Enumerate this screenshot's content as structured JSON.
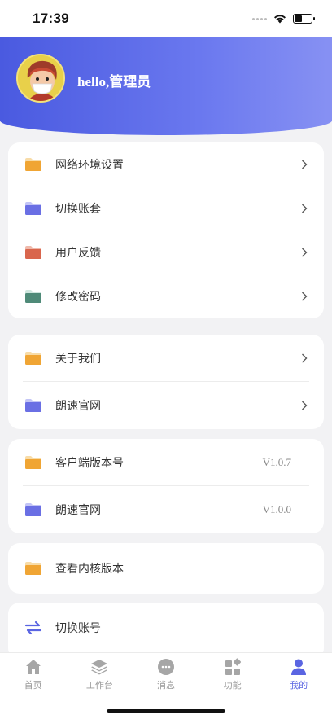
{
  "status_bar": {
    "time": "17:39"
  },
  "header": {
    "greeting": "hello,管理员"
  },
  "groups": [
    {
      "items": [
        {
          "label": "网络环境设置",
          "icon": "folder-orange-icon",
          "chevron": true
        },
        {
          "label": "切换账套",
          "icon": "folder-purple-icon",
          "chevron": true
        },
        {
          "label": "用户反馈",
          "icon": "folder-red-icon",
          "chevron": true
        },
        {
          "label": "修改密码",
          "icon": "folder-green-icon",
          "chevron": true
        }
      ]
    },
    {
      "items": [
        {
          "label": "关于我们",
          "icon": "folder-orange-icon",
          "chevron": true
        },
        {
          "label": "朗速官网",
          "icon": "folder-purple-icon",
          "chevron": true
        }
      ]
    },
    {
      "items": [
        {
          "label": "客户端版本号",
          "icon": "folder-orange-icon",
          "value": "V1.0.7"
        },
        {
          "label": "朗速官网",
          "icon": "folder-purple-icon",
          "value": "V1.0.0"
        }
      ]
    },
    {
      "items": [
        {
          "label": "查看内核版本",
          "icon": "folder-orange-icon"
        }
      ]
    },
    {
      "items": [
        {
          "label": "切换账号",
          "icon": "swap-arrows-icon"
        }
      ]
    }
  ],
  "tabbar": {
    "tabs": [
      {
        "label": "首页",
        "icon": "home-icon"
      },
      {
        "label": "工作台",
        "icon": "layers-icon"
      },
      {
        "label": "消息",
        "icon": "chat-bubble-icon"
      },
      {
        "label": "功能",
        "icon": "apps-grid-icon"
      },
      {
        "label": "我的",
        "icon": "user-icon"
      }
    ],
    "active_index": 4
  },
  "colors": {
    "accent": "#5a65e2",
    "header_start": "#4a5ae0",
    "header_end": "#8791f3",
    "folder_orange": "#f0a534",
    "folder_purple": "#6a6fe4",
    "folder_red": "#d9664d",
    "folder_green": "#4f8a78"
  }
}
